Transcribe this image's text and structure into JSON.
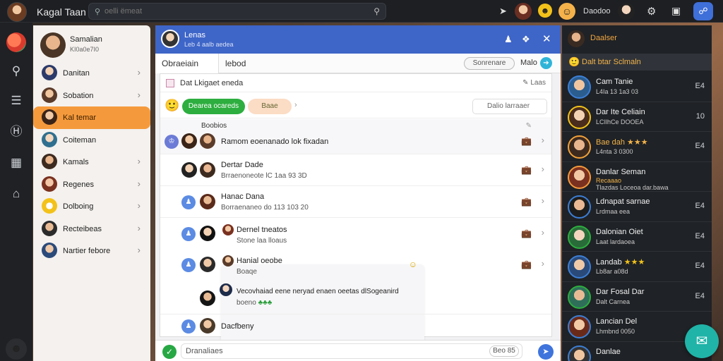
{
  "app": {
    "title": "Kagal Taan"
  },
  "search": {
    "value": "",
    "placeholder": "oelli ëmeat"
  },
  "topbar": {
    "user_name": "Daodoo"
  },
  "colors": {
    "accent_blue": "#3e65c8",
    "active_orange": "#f59a3c",
    "green": "#2dae3f",
    "teal": "#20b3a8"
  },
  "sidebar": {
    "me": {
      "name": "Samalian",
      "sub": "KI0a0e7I0"
    },
    "items": [
      {
        "label": "Danitan"
      },
      {
        "label": "Sobation"
      },
      {
        "label": "Kal temar",
        "active": true
      },
      {
        "label": "Coiteman"
      },
      {
        "label": "Kamals"
      },
      {
        "label": "Regenes"
      },
      {
        "label": "Dolboing"
      },
      {
        "label": "Recteibeas"
      },
      {
        "label": "Nartier febore"
      }
    ]
  },
  "chat": {
    "header": {
      "title": "Lenas",
      "subtitle": "Leb 4 aalb aedea"
    },
    "tabs": {
      "active": "Obraeiain",
      "other": "lebod",
      "pill": "Sonrenare",
      "mode": "Malo"
    },
    "subline": {
      "text": "Dat Lkigaet eneda",
      "right": "Laas"
    },
    "actions": {
      "green_button": "Dearea ocareds",
      "orange_button": "Baae",
      "search": "Dalio larraaer"
    },
    "messages": [
      {
        "header": "Boobios",
        "line1": "Ramom eoenanado lok fixadan",
        "line2": ""
      },
      {
        "line1": "Dertar Dade",
        "line2": "Brraenoneote lC 1aa 93 3D"
      },
      {
        "line1": "Hanac Dana",
        "line2": "Borraenaneo do 113 103 20"
      },
      {
        "line1": "Dernel tneatos",
        "line2": "Stone laa lloaus"
      },
      {
        "line1": "Hanial oeobe",
        "line2": "Boaqe"
      },
      {
        "line1": "Vecovhaiad eene neryad enaen oeetas dlSogeanird",
        "line2": "boeno"
      },
      {
        "line1": "Dacfbeny",
        "line2": ""
      }
    ],
    "composer": {
      "placeholder": "Dranaliaes",
      "counter": "Beo 85"
    }
  },
  "right_panel": {
    "title": "Daalser",
    "subtitle": "Dalt btar Sclmaln",
    "items": [
      {
        "name": "Cam Tanie",
        "sub": "L4Ia 13 1a3 03",
        "right": "E4"
      },
      {
        "name": "Dar Ite Celiain",
        "sub": "LCIlhCe DOOEA",
        "right": "10"
      },
      {
        "name": "Bae dah",
        "sub": "L4nta 3 0300",
        "right": "E4"
      },
      {
        "name": "Danlar Seman",
        "sub": "Recaaao",
        "sub2": "Tlazdas Loceoa dar.bawa",
        "right": ""
      },
      {
        "name": "Ldnapat sarnae",
        "sub": "Lrdmaa eea",
        "right": "E4"
      },
      {
        "name": "Dalonian Oiet",
        "sub": "Laat lardaoea",
        "right": "E4"
      },
      {
        "name": "Landab",
        "sub": "Lb8ar a08d",
        "right": "E4"
      },
      {
        "name": "Dar Fosal Dar",
        "sub": "Dalt Carnea",
        "right": "E4"
      },
      {
        "name": "Lancian Del",
        "sub": "Lhmbnd 0050",
        "right": ""
      },
      {
        "name": "Danlae",
        "sub": "",
        "right": ""
      }
    ]
  }
}
